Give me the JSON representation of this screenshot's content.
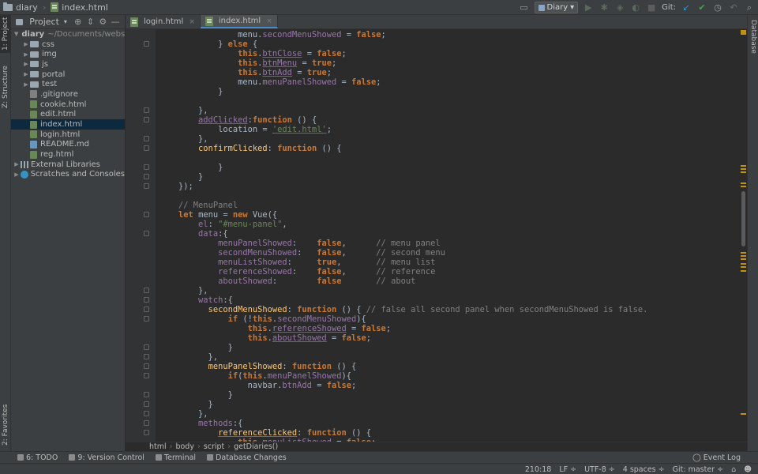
{
  "nav": {
    "project": "diary",
    "file": "index.html"
  },
  "toolbar": {
    "run_config": "Diary",
    "git_label": "Git:"
  },
  "left_stripe": {
    "project_tab": "1: Project",
    "structure_tab": "Z: Structure",
    "favorites_tab": "2: Favorites"
  },
  "project_panel": {
    "title": "Project",
    "tree": [
      {
        "label": "diary",
        "extra": "~/Documents/website/",
        "type": "root"
      },
      {
        "label": "css",
        "type": "folder"
      },
      {
        "label": "img",
        "type": "folder"
      },
      {
        "label": "js",
        "type": "folder"
      },
      {
        "label": "portal",
        "type": "folder"
      },
      {
        "label": "test",
        "type": "folder"
      },
      {
        "label": ".gitignore",
        "type": "gi"
      },
      {
        "label": "cookie.html",
        "type": "html"
      },
      {
        "label": "edit.html",
        "type": "html"
      },
      {
        "label": "index.html",
        "type": "html",
        "selected": true
      },
      {
        "label": "login.html",
        "type": "html"
      },
      {
        "label": "README.md",
        "type": "md"
      },
      {
        "label": "reg.html",
        "type": "html"
      },
      {
        "label": "External Libraries",
        "type": "lib"
      },
      {
        "label": "Scratches and Consoles",
        "type": "scratch"
      }
    ]
  },
  "tabs": [
    {
      "label": "login.html",
      "active": false
    },
    {
      "label": "index.html",
      "active": true
    }
  ],
  "right_stripe": {
    "database_tab": "Database"
  },
  "code_lines": [
    [
      [
        "                ",
        ""
      ],
      [
        "menu",
        ""
      ],
      [
        ".",
        ""
      ],
      [
        "secondMenuShowed",
        "prop"
      ],
      [
        " = ",
        ""
      ],
      [
        "false",
        "kw"
      ],
      [
        ";",
        ""
      ]
    ],
    [
      [
        "            } ",
        ""
      ],
      [
        "else",
        "kw"
      ],
      [
        " {",
        ""
      ]
    ],
    [
      [
        "                ",
        ""
      ],
      [
        "this",
        "kw"
      ],
      [
        ".",
        ""
      ],
      [
        "btnClose",
        "prop ul"
      ],
      [
        " = ",
        ""
      ],
      [
        "false",
        "kw"
      ],
      [
        ";",
        ""
      ]
    ],
    [
      [
        "                ",
        ""
      ],
      [
        "this",
        "kw"
      ],
      [
        ".",
        ""
      ],
      [
        "btnMenu",
        "prop ul"
      ],
      [
        " = ",
        ""
      ],
      [
        "true",
        "kw"
      ],
      [
        ";",
        ""
      ]
    ],
    [
      [
        "                ",
        ""
      ],
      [
        "this",
        "kw"
      ],
      [
        ".",
        ""
      ],
      [
        "btnAdd",
        "prop ul"
      ],
      [
        " = ",
        ""
      ],
      [
        "true",
        "kw"
      ],
      [
        ";",
        ""
      ]
    ],
    [
      [
        "                ",
        ""
      ],
      [
        "menu",
        ""
      ],
      [
        ".",
        ""
      ],
      [
        "menuPanelShowed",
        "prop"
      ],
      [
        " = ",
        ""
      ],
      [
        "false",
        "kw"
      ],
      [
        ";",
        ""
      ]
    ],
    [
      [
        "            }",
        ""
      ]
    ],
    [
      [
        "",
        ""
      ]
    ],
    [
      [
        "        },",
        ""
      ]
    ],
    [
      [
        "        ",
        ""
      ],
      [
        "addClicked",
        "prop ul"
      ],
      [
        ":",
        ""
      ],
      [
        "function",
        "kw"
      ],
      [
        " () {",
        ""
      ]
    ],
    [
      [
        "            location = ",
        ""
      ],
      [
        "'edit.html'",
        "str ul"
      ],
      [
        ";",
        ""
      ]
    ],
    [
      [
        "        },",
        ""
      ]
    ],
    [
      [
        "        ",
        ""
      ],
      [
        "confirmClicked",
        "fn"
      ],
      [
        ": ",
        ""
      ],
      [
        "function",
        "kw"
      ],
      [
        " () {",
        ""
      ]
    ],
    [
      [
        "",
        ""
      ]
    ],
    [
      [
        "            }",
        ""
      ]
    ],
    [
      [
        "        }",
        ""
      ]
    ],
    [
      [
        "    });",
        ""
      ]
    ],
    [
      [
        "",
        ""
      ]
    ],
    [
      [
        "    ",
        ""
      ],
      [
        "// MenuPanel",
        "cm"
      ]
    ],
    [
      [
        "    ",
        ""
      ],
      [
        "let",
        "kw"
      ],
      [
        " menu = ",
        ""
      ],
      [
        "new",
        "kw"
      ],
      [
        " Vue({",
        ""
      ]
    ],
    [
      [
        "        ",
        ""
      ],
      [
        "el",
        "prop"
      ],
      [
        ": ",
        ""
      ],
      [
        "\"#menu-panel\"",
        "str"
      ],
      [
        ",",
        ""
      ]
    ],
    [
      [
        "        ",
        ""
      ],
      [
        "data",
        "prop"
      ],
      [
        ":{",
        ""
      ]
    ],
    [
      [
        "            ",
        ""
      ],
      [
        "menuPanelShowed",
        "prop"
      ],
      [
        ":    ",
        ""
      ],
      [
        "false",
        "kw"
      ],
      [
        ",      ",
        ""
      ],
      [
        "// menu panel",
        "cm"
      ]
    ],
    [
      [
        "            ",
        ""
      ],
      [
        "secondMenuShowed",
        "prop"
      ],
      [
        ":   ",
        ""
      ],
      [
        "false",
        "kw"
      ],
      [
        ",      ",
        ""
      ],
      [
        "// second menu",
        "cm"
      ]
    ],
    [
      [
        "            ",
        ""
      ],
      [
        "menuListShowed",
        "prop"
      ],
      [
        ":     ",
        ""
      ],
      [
        "true",
        "kw"
      ],
      [
        ",       ",
        ""
      ],
      [
        "// menu list",
        "cm"
      ]
    ],
    [
      [
        "            ",
        ""
      ],
      [
        "referenceShowed",
        "prop"
      ],
      [
        ":    ",
        ""
      ],
      [
        "false",
        "kw"
      ],
      [
        ",      ",
        ""
      ],
      [
        "// reference",
        "cm"
      ]
    ],
    [
      [
        "            ",
        ""
      ],
      [
        "aboutShowed",
        "prop"
      ],
      [
        ":        ",
        ""
      ],
      [
        "false",
        "kw"
      ],
      [
        "       ",
        ""
      ],
      [
        "// about",
        "cm"
      ]
    ],
    [
      [
        "        },",
        ""
      ]
    ],
    [
      [
        "        ",
        ""
      ],
      [
        "watch",
        "prop"
      ],
      [
        ":{",
        ""
      ]
    ],
    [
      [
        "          ",
        ""
      ],
      [
        "secondMenuShowed",
        "fn"
      ],
      [
        ": ",
        ""
      ],
      [
        "function",
        "kw"
      ],
      [
        " () { ",
        ""
      ],
      [
        "// false all second panel when secondMenuShowed is false.",
        "cm"
      ]
    ],
    [
      [
        "              ",
        ""
      ],
      [
        "if",
        "kw"
      ],
      [
        " (!",
        ""
      ],
      [
        "this",
        "kw"
      ],
      [
        ".",
        ""
      ],
      [
        "secondMenuShowed",
        "prop"
      ],
      [
        "){",
        ""
      ]
    ],
    [
      [
        "                  ",
        ""
      ],
      [
        "this",
        "kw"
      ],
      [
        ".",
        ""
      ],
      [
        "referenceShowed",
        "prop ul"
      ],
      [
        " = ",
        ""
      ],
      [
        "false",
        "kw"
      ],
      [
        ";",
        ""
      ]
    ],
    [
      [
        "                  ",
        ""
      ],
      [
        "this",
        "kw"
      ],
      [
        ".",
        ""
      ],
      [
        "aboutShowed",
        "prop ul"
      ],
      [
        " = ",
        ""
      ],
      [
        "false",
        "kw"
      ],
      [
        ";",
        ""
      ]
    ],
    [
      [
        "              }",
        ""
      ]
    ],
    [
      [
        "          },",
        ""
      ]
    ],
    [
      [
        "          ",
        ""
      ],
      [
        "menuPanelShowed",
        "fn"
      ],
      [
        ": ",
        ""
      ],
      [
        "function",
        "kw"
      ],
      [
        " () {",
        ""
      ]
    ],
    [
      [
        "              ",
        ""
      ],
      [
        "if",
        "kw"
      ],
      [
        "(",
        ""
      ],
      [
        "this",
        "kw"
      ],
      [
        ".",
        ""
      ],
      [
        "menuPanelShowed",
        "prop"
      ],
      [
        "){",
        ""
      ]
    ],
    [
      [
        "                  navbar.",
        ""
      ],
      [
        "btnAdd",
        "prop"
      ],
      [
        " = ",
        ""
      ],
      [
        "false",
        "kw"
      ],
      [
        ";",
        ""
      ]
    ],
    [
      [
        "              }",
        ""
      ]
    ],
    [
      [
        "          }",
        ""
      ]
    ],
    [
      [
        "        },",
        ""
      ]
    ],
    [
      [
        "        ",
        ""
      ],
      [
        "methods",
        "prop"
      ],
      [
        ":{",
        ""
      ]
    ],
    [
      [
        "            ",
        ""
      ],
      [
        "referenceClicked",
        "fn ul"
      ],
      [
        ": ",
        ""
      ],
      [
        "function",
        "kw"
      ],
      [
        " () {",
        ""
      ]
    ],
    [
      [
        "                ",
        ""
      ],
      [
        "this",
        "kw"
      ],
      [
        ".",
        ""
      ],
      [
        "menuListShowed",
        "prop"
      ],
      [
        " = ",
        ""
      ],
      [
        "false",
        "kw"
      ],
      [
        ";",
        ""
      ]
    ]
  ],
  "breadcrumb": [
    "html",
    "body",
    "script",
    "getDiaries()"
  ],
  "bottom_tools": [
    {
      "label": "6: TODO"
    },
    {
      "label": "9: Version Control"
    },
    {
      "label": "Terminal"
    },
    {
      "label": "Database Changes"
    }
  ],
  "event_log": "Event Log",
  "status": {
    "position": "210:18",
    "line_sep": "LF ÷",
    "encoding": "UTF-8 ÷",
    "indent": "4 spaces ÷",
    "git": "Git: master ÷"
  },
  "colors": {
    "keyword": "#cc7832",
    "property": "#9876aa",
    "function": "#ffc66d",
    "string": "#6a8759",
    "comment": "#808080"
  }
}
